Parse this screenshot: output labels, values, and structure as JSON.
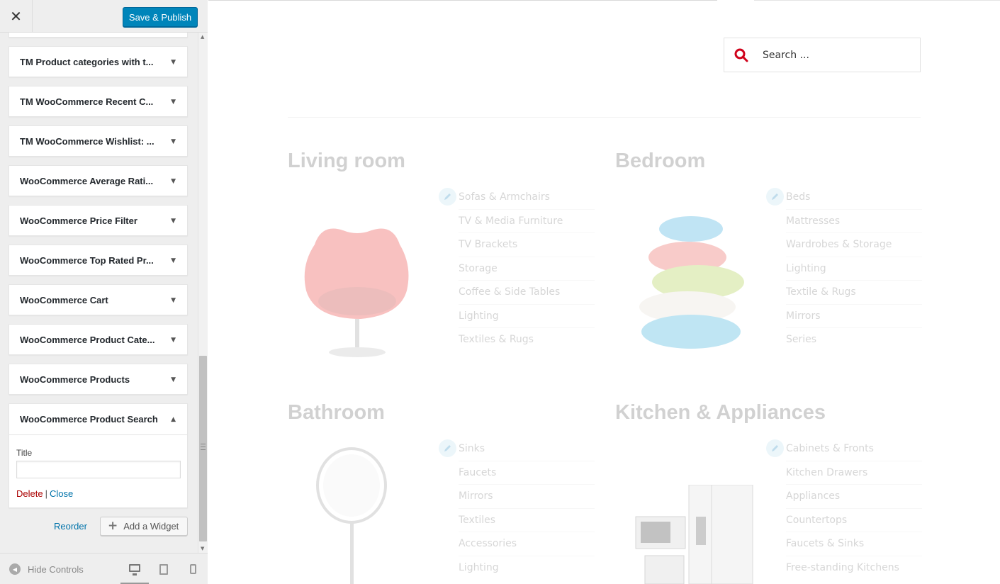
{
  "header": {
    "close_symbol": "✕",
    "save_label": "Save & Publish"
  },
  "widgets": [
    {
      "title": "TM Product categories with t..."
    },
    {
      "title": "TM WooCommerce Recent C..."
    },
    {
      "title": "TM WooCommerce Wishlist: ..."
    },
    {
      "title": "WooCommerce Average Rati..."
    },
    {
      "title": "WooCommerce Price Filter"
    },
    {
      "title": "WooCommerce Top Rated Pr..."
    },
    {
      "title": "WooCommerce Cart"
    },
    {
      "title": "WooCommerce Product Cate..."
    },
    {
      "title": "WooCommerce Products"
    }
  ],
  "open_widget": {
    "title": "WooCommerce Product Search",
    "field_label": "Title",
    "field_value": "",
    "delete_label": "Delete",
    "separator": "|",
    "close_label": "Close"
  },
  "widget_arrows": {
    "collapsed": "▼",
    "expanded": "▲"
  },
  "sidebar_actions": {
    "reorder_label": "Reorder",
    "add_widget_label": "Add a Widget",
    "add_symbol": "+"
  },
  "footer": {
    "hide_controls_label": "Hide Controls",
    "hide_symbol": "◀",
    "devices": [
      "desktop",
      "tablet",
      "mobile"
    ],
    "active_device": "desktop"
  },
  "preview": {
    "search_placeholder": "Search ...",
    "accent_color": "#d0021b",
    "categories": [
      {
        "title": "Living room",
        "items": [
          "Sofas & Armchairs",
          "TV & Media Furniture",
          "TV Brackets",
          "Storage",
          "Coffee & Side Tables",
          "Lighting",
          "Textiles & Rugs"
        ]
      },
      {
        "title": "Bedroom",
        "items": [
          "Beds",
          "Mattresses",
          "Wardrobes & Storage",
          "Lighting",
          "Textile & Rugs",
          "Mirrors",
          "Series"
        ]
      },
      {
        "title": "Bathroom",
        "items": [
          "Sinks",
          "Faucets",
          "Mirrors",
          "Textiles",
          "Accessories",
          "Lighting"
        ]
      },
      {
        "title": "Kitchen & Appliances",
        "items": [
          "Cabinets & Fronts",
          "Kitchen Drawers",
          "Appliances",
          "Countertops",
          "Faucets & Sinks",
          "Free-standing Kitchens"
        ]
      }
    ]
  }
}
